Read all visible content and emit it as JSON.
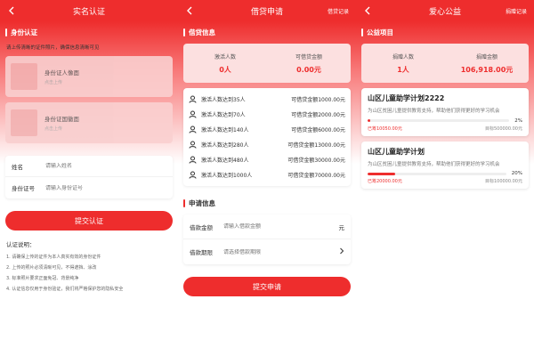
{
  "colors": {
    "accent": "#ee2d2d"
  },
  "screen1": {
    "title": "实名认证",
    "section_title": "身份认证",
    "tip": "请上传清晰的证件照片，确保信息清晰可见",
    "upload_front": {
      "label": "身份证人像面",
      "hint": "点击上传"
    },
    "upload_back": {
      "label": "身份证国徽面",
      "hint": "点击上传"
    },
    "name_label": "姓名",
    "name_placeholder": "请输入姓名",
    "id_label": "身份证号",
    "id_placeholder": "请输入身份证号",
    "submit_label": "提交认证",
    "notes_title": "认证说明：",
    "notes": [
      "1. 请确保上传的证件为本人真实有效的身份证件",
      "2. 上传的照片必须清晰可见，不得遮挡、涂改",
      "3. 标准照片要求正面免冠、背景纯净",
      "4. 认证信息仅用于身份验证，我们将严格保护您的隐私安全"
    ]
  },
  "screen2": {
    "title": "借贷申请",
    "right_link": "借贷记录",
    "section_title": "借贷信息",
    "stats": [
      {
        "label": "激活人数",
        "value": "0人"
      },
      {
        "label": "可借贷金额",
        "value": "0.00元"
      }
    ],
    "tiers": [
      {
        "label": "激活人数达到35人",
        "amount": "可借贷金额1000.00元"
      },
      {
        "label": "激活人数达到70人",
        "amount": "可借贷金额2000.00元"
      },
      {
        "label": "激活人数达到140人",
        "amount": "可借贷金额6000.00元"
      },
      {
        "label": "激活人数达到280人",
        "amount": "可借贷金额13000.00元"
      },
      {
        "label": "激活人数达到480人",
        "amount": "可借贷金额30000.00元"
      },
      {
        "label": "激活人数达到1000人",
        "amount": "可借贷金额70000.00元"
      }
    ],
    "apply_title": "申请信息",
    "amount_label": "借款金额",
    "amount_placeholder": "请输入借款金额",
    "amount_suffix": "元",
    "term_label": "借款期限",
    "term_placeholder": "请选择借款期限",
    "submit_label": "提交申请"
  },
  "screen3": {
    "title": "爱心公益",
    "right_link": "捐赠记录",
    "section_title": "公益项目",
    "stats": [
      {
        "label": "捐赠人数",
        "value": "1人"
      },
      {
        "label": "捐赠金额",
        "value": "106,918.00元"
      }
    ],
    "projects": [
      {
        "title": "山区儿童助学计划2222",
        "desc": "为山区贫困儿童提供教育支持，帮助他们获得更好的学习机会",
        "progress": 0.02,
        "pct": "2%",
        "raised": "已筹10050.00元",
        "target": "目标500000.00元"
      },
      {
        "title": "山区儿童助学计划",
        "desc": "为山区贫困儿童提供教育支持，帮助他们获得更好的学习机会",
        "progress": 0.2,
        "pct": "20%",
        "raised": "已筹20000.00元",
        "target": "目标100000.00元"
      }
    ]
  }
}
